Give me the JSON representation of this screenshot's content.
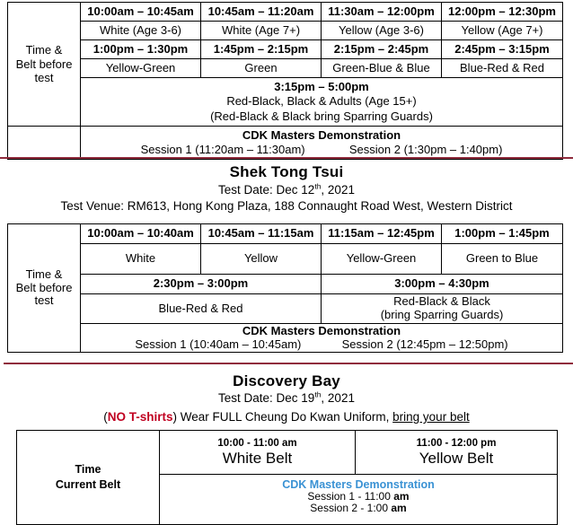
{
  "colors": {
    "divider": "#8f2b3c",
    "warning_red": "#c00020",
    "demo_blue": "#3a92d4",
    "table_border": "#000000",
    "table_border_light": "#7a7a7a"
  },
  "section1": {
    "row_header": "Time &\nBelt before\ntest",
    "row_header_line1": "Time &",
    "row_header_line2": "Belt before",
    "row_header_line3": "test",
    "morning_times": [
      "10:00am – 10:45am",
      "10:45am – 11:20am",
      "11:30am – 12:00pm",
      "12:00pm – 12:30pm"
    ],
    "morning_belts": [
      "White (Age 3-6)",
      "White (Age 7+)",
      "Yellow (Age 3-6)",
      "Yellow (Age 7+)"
    ],
    "afternoon_times": [
      "1:00pm – 1:30pm",
      "1:45pm – 2:15pm",
      "2:15pm – 2:45pm",
      "2:45pm – 3:15pm"
    ],
    "afternoon_belts": [
      "Yellow-Green",
      "Green",
      "Green-Blue & Blue",
      "Blue-Red & Red"
    ],
    "late_block": {
      "time": "3:15pm – 5:00pm",
      "belts": "Red-Black, Black & Adults (Age 15+)",
      "note": "(Red-Black & Black bring Sparring Guards)"
    },
    "demo": {
      "title": "CDK Masters Demonstration",
      "session1": "Session 1 (11:20am – 11:30am)",
      "session2": "Session 2 (1:30pm – 1:40pm)"
    }
  },
  "section2": {
    "title": "Shek Tong Tsui",
    "test_date_label": "Test Date: Dec 12",
    "test_date_sup": "th",
    "test_date_year": ", 2021",
    "venue": "Test Venue:  RM613, Hong Kong Plaza, 188 Connaught Road West, Western District",
    "row_header_line1": "Time &",
    "row_header_line2": "Belt before",
    "row_header_line3": "test",
    "morning_times": [
      "10:00am – 10:40am",
      "10:45am – 11:15am",
      "11:15am – 12:45pm",
      "1:00pm – 1:45pm"
    ],
    "morning_belts": [
      "White",
      "Yellow",
      "Yellow-Green",
      "Green to Blue"
    ],
    "afternoon_times": [
      "2:30pm – 3:00pm",
      "3:00pm – 4:30pm"
    ],
    "afternoon_belts": [
      "Blue-Red & Red",
      "Red-Black & Black\n(bring Sparring Guards)"
    ],
    "afternoon_belt_2_line1": "Red-Black & Black",
    "afternoon_belt_2_line2": "(bring Sparring Guards)",
    "demo": {
      "title": "CDK Masters Demonstration",
      "session1": "Session 1 (10:40am – 10:45am)",
      "session2": "Session 2 (12:45pm – 12:50pm)"
    }
  },
  "section3": {
    "title": "Discovery Bay",
    "test_date_label": "Test Date: Dec 19",
    "test_date_sup": "th",
    "test_date_year": ", 2021",
    "uniform_note_open": "(",
    "uniform_note_warn": "NO T-shirts",
    "uniform_note_mid": ") Wear FULL Cheung Do Kwan Uniform, ",
    "uniform_note_underline": "bring your belt",
    "row_header_line1": "Time",
    "row_header_line2": "Current Belt",
    "slots": [
      {
        "time": "10:00 - 11:00 am",
        "belt": "White Belt"
      },
      {
        "time": "11:00 - 12:00 pm",
        "belt": "Yellow Belt"
      }
    ],
    "demo": {
      "title": "CDK Masters Demonstration",
      "session1_pre": "Session 1 - 11:00 ",
      "session1_bold": "am",
      "session2_pre": "Session 2 - 1:00 ",
      "session2_bold": "am"
    }
  }
}
